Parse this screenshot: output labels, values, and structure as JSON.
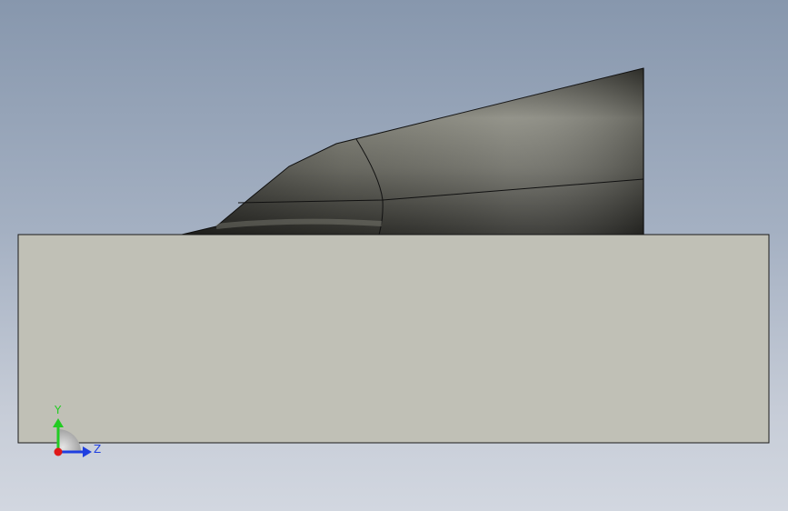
{
  "viewport": {
    "background_top": "#8797ad",
    "background_bottom": "#d2d7e0"
  },
  "model": {
    "base_block_color": "#c0c0b6",
    "base_block_edge": "#1a1a1a",
    "duct_shell_color": "#6f6f67",
    "edge_line_color": "#111111"
  },
  "triad": {
    "y_axis": {
      "label": "Y",
      "color": "#22cc22"
    },
    "z_axis": {
      "label": "Z",
      "color": "#1f3fe0"
    },
    "x_axis": {
      "color": "#e01818"
    },
    "icon": "view-triad-icon"
  }
}
